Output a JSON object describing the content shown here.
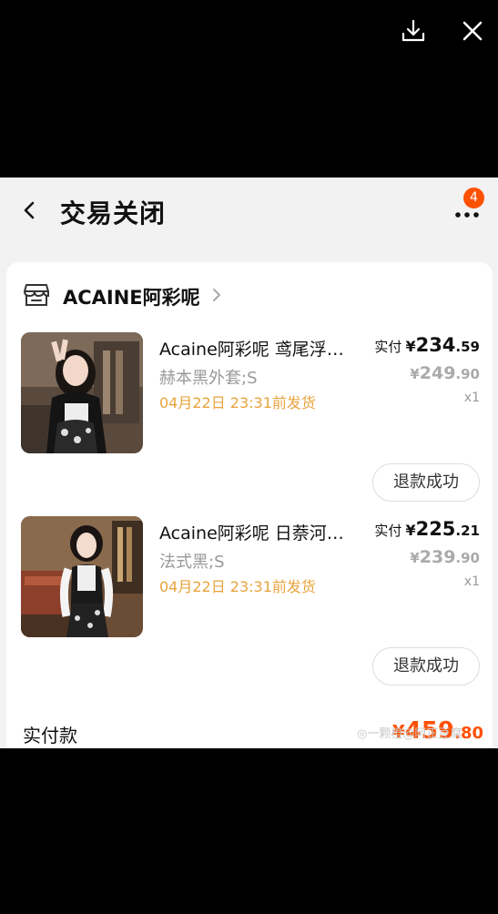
{
  "viewer": {
    "download_icon": "download-icon",
    "close_icon": "close-icon"
  },
  "header": {
    "title": "交易关闭",
    "notification_count": "4"
  },
  "store": {
    "name": "ACAINE阿彩呢"
  },
  "items": [
    {
      "name": "Acaine阿彩呢 鸢尾浮…",
      "sku": "赫本黑外套;S",
      "ship_by": "04月22日 23:31前发货",
      "paid_label": "实付",
      "paid_yen": "¥",
      "paid_int": "234",
      "paid_dec": ".59",
      "orig_yen": "¥",
      "orig_int": "249",
      "orig_dec": ".90",
      "qty": "x1",
      "status": "退款成功"
    },
    {
      "name": "Acaine阿彩呢 日萘河…",
      "sku": "法式黑;S",
      "ship_by": "04月22日 23:31前发货",
      "paid_label": "实付",
      "paid_yen": "¥",
      "paid_int": "225",
      "paid_dec": ".21",
      "orig_yen": "¥",
      "orig_int": "239",
      "orig_dec": ".90",
      "qty": "x1",
      "status": "退款成功"
    }
  ],
  "total": {
    "label": "实付款",
    "yen": "¥",
    "int": "459",
    "dec": ".80"
  },
  "watermark": "◎一颗橙@阿正豆腐"
}
